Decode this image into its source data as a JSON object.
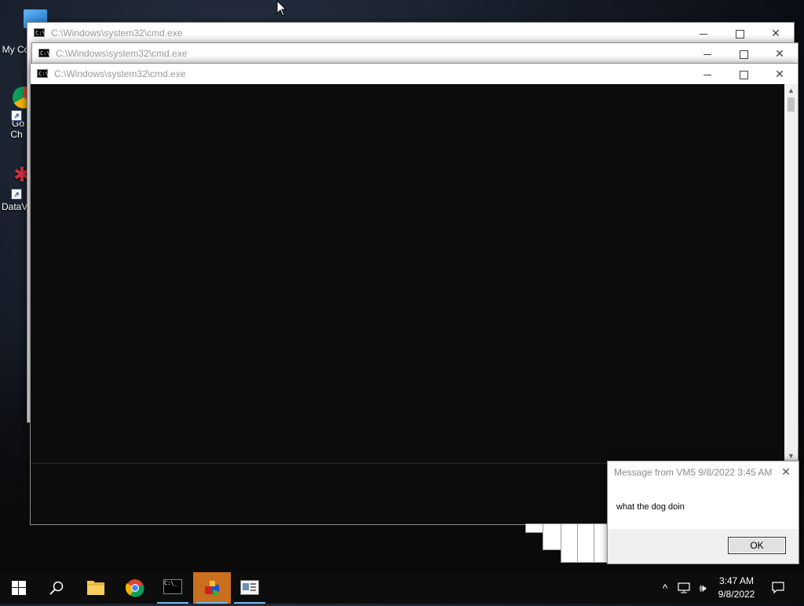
{
  "desktop": {
    "icons": [
      {
        "label": "My Co",
        "icon": "computer-icon"
      },
      {
        "label": "Go",
        "label2": "Ch",
        "icon": "chrome-icon"
      },
      {
        "label": "DataV",
        "icon": "datavision-icon"
      }
    ]
  },
  "windows": [
    {
      "title": "C:\\Windows\\system32\\cmd.exe"
    },
    {
      "title": "C:\\Windows\\system32\\cmd.exe"
    },
    {
      "title": "C:\\Windows\\system32\\cmd.exe"
    }
  ],
  "message_box": {
    "title": "Message from VM5 9/8/2022 3:45 AM",
    "text": "what the dog doin",
    "ok_label": "OK"
  },
  "taskbar": {
    "items": [
      "start-icon",
      "search-icon",
      "file-explorer-icon",
      "chrome-icon",
      "cmd-icon",
      "app-icon",
      "message-icon"
    ],
    "clock_time": "3:47 AM",
    "clock_date": "9/8/2022"
  },
  "colors": {
    "console_bg": "#0c0c0c",
    "taskbar_bg": "#0d0d0d",
    "active_indicator": "#76b9ed",
    "selected_task": "#c96f1e"
  }
}
